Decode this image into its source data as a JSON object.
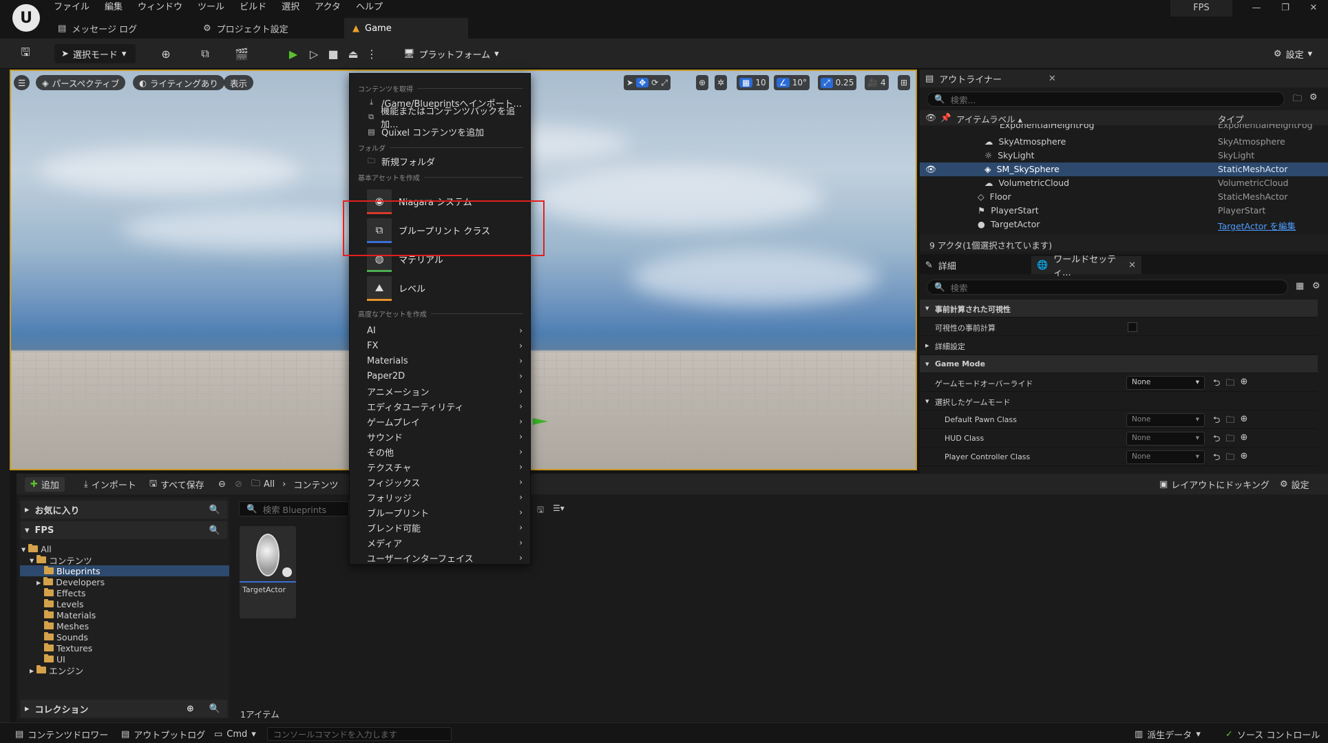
{
  "app": {
    "logo": "U",
    "project": "FPS"
  },
  "menu": [
    "ファイル",
    "編集",
    "ウィンドウ",
    "ツール",
    "ビルド",
    "選択",
    "アクタ",
    "ヘルプ"
  ],
  "window_controls": {
    "minimize": "—",
    "maximize": "❐",
    "close": "✕"
  },
  "tabs": [
    {
      "label": "メッセージ ログ",
      "icon": "log-icon"
    },
    {
      "label": "プロジェクト設定",
      "icon": "settings-gear-icon"
    },
    {
      "label": "Game",
      "icon": "ue-level-icon"
    }
  ],
  "toolbar": {
    "mode": "選択モード",
    "platform": "プラットフォーム",
    "settings": "設定"
  },
  "viewport": {
    "perspective": "パースペクティブ",
    "lighting": "ライティングあり",
    "show": "表示",
    "grid_snap": "10",
    "rot_snap": "10°",
    "scale_snap": "0.25",
    "camera_speed": "4"
  },
  "context_menu": {
    "section_content": "コンテンツを取得",
    "content_items": [
      "/Game/Blueprintsへインポート...",
      "機能またはコンテンツパックを追加...",
      "Quixel コンテンツを追加"
    ],
    "section_folder": "フォルダ",
    "folder_items": [
      "新規フォルダ"
    ],
    "section_basic": "基本アセットを作成",
    "basic_assets": [
      {
        "label": "Niagara システム",
        "color": "#d83a2a"
      },
      {
        "label": "ブループリント クラス",
        "color": "#3a6fd8"
      },
      {
        "label": "マテリアル",
        "color": "#4caf50"
      },
      {
        "label": "レベル",
        "color": "#e8922a"
      }
    ],
    "section_advanced": "高度なアセットを作成",
    "advanced_items": [
      "AI",
      "FX",
      "Materials",
      "Paper2D",
      "アニメーション",
      "エディタユーティリティ",
      "ゲームプレイ",
      "サウンド",
      "その他",
      "テクスチャ",
      "フィジックス",
      "フォリッジ",
      "ブループリント",
      "ブレンド可能",
      "メディア",
      "ユーザーインターフェイス"
    ]
  },
  "outliner": {
    "title": "アウトライナー",
    "search_placeholder": "検索...",
    "col_label": "アイテムラベル ▴",
    "col_type": "タイプ",
    "rows": [
      {
        "name": "ExponentialHeightFog",
        "type": "ExponentialHeightFog"
      },
      {
        "name": "SkyAtmosphere",
        "type": "SkyAtmosphere"
      },
      {
        "name": "SkyLight",
        "type": "SkyLight"
      },
      {
        "name": "SM_SkySphere",
        "type": "StaticMeshActor"
      },
      {
        "name": "VolumetricCloud",
        "type": "VolumetricCloud"
      },
      {
        "name": "Floor",
        "type": "StaticMeshActor"
      },
      {
        "name": "PlayerStart",
        "type": "PlayerStart"
      },
      {
        "name": "TargetActor",
        "type": "TargetActor を編集"
      }
    ],
    "status": "9 アクタ(1個選択されています)"
  },
  "details": {
    "tab1": "詳細",
    "tab2": "ワールドセッティ...",
    "search_placeholder": "検索",
    "rows": [
      {
        "label": "事前計算された可視性",
        "kind": "cat"
      },
      {
        "label": "可視性の事前計算",
        "kind": "check"
      },
      {
        "label": "詳細設定",
        "kind": "collapsed"
      },
      {
        "label": "Game Mode",
        "kind": "cat"
      },
      {
        "label": "ゲームモードオーバーライド",
        "kind": "dropdown",
        "value": "None"
      },
      {
        "label": "選択したゲームモード",
        "kind": "sub"
      },
      {
        "label": "Default Pawn Class",
        "kind": "dropdown",
        "value": "None"
      },
      {
        "label": "HUD Class",
        "kind": "dropdown",
        "value": "None"
      },
      {
        "label": "Player Controller Class",
        "kind": "dropdown",
        "value": "None"
      }
    ]
  },
  "content_browser": {
    "add": "追加",
    "import": "インポート",
    "save_all": "すべて保存",
    "breadcrumb": [
      "All",
      "コンテンツ"
    ],
    "dock": "レイアウトにドッキング",
    "settings": "設定",
    "favorites": "お気に入り",
    "project": "FPS",
    "tree": [
      "All",
      "コンテンツ",
      "Blueprints",
      "Developers",
      "Effects",
      "Levels",
      "Materials",
      "Meshes",
      "Sounds",
      "Textures",
      "UI",
      "エンジン"
    ],
    "collections": "コレクション",
    "search_placeholder": "検索 Blueprints",
    "asset_name": "TargetActor",
    "item_count": "1アイテム"
  },
  "statusbar": {
    "content_drawer": "コンテンツドロワー",
    "output_log": "アウトプットログ",
    "cmd": "Cmd",
    "console_placeholder": "コンソールコマンドを入力します",
    "derived_data": "派生データ",
    "source_control": "ソース コントロール"
  }
}
